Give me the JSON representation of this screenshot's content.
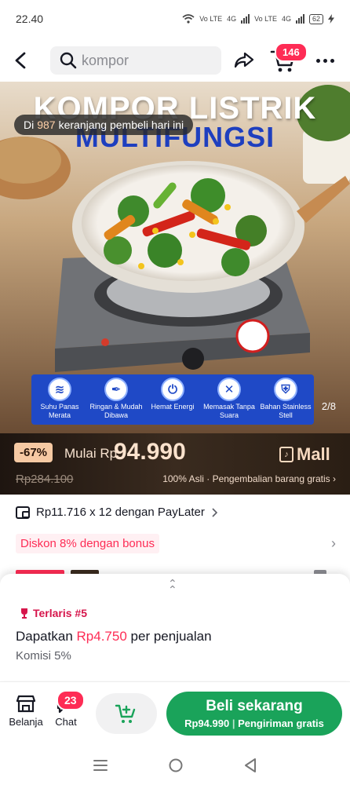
{
  "status_bar": {
    "time": "22.40",
    "network1": "Vo LTE",
    "network_type1": "4G",
    "network2": "Vo LTE",
    "network_type2": "4G",
    "battery": "62"
  },
  "top_nav": {
    "search_text": "kompor",
    "cart_count": "146"
  },
  "hero": {
    "title_line1": "KOMPOR LISTRIK",
    "title_line2": "MULTIFUNGSI",
    "buyers_prefix": "Di",
    "buyers_count": "987",
    "buyers_suffix": "keranjang pembeli hari ini",
    "page_indicator": "2/8",
    "features": [
      {
        "label": "Suhu Panas Merata",
        "icon": "heat-icon"
      },
      {
        "label": "Ringan & Mudah Dibawa",
        "icon": "feather-icon"
      },
      {
        "label": "Hemat Energi",
        "icon": "energy-icon"
      },
      {
        "label": "Memasak Tanpa Suara",
        "icon": "mute-icon"
      },
      {
        "label": "Bahan Stainless Stell",
        "icon": "shield-icon"
      }
    ]
  },
  "price_bar": {
    "discount": "-67%",
    "mulai": "Mulai Rp",
    "price": "94.990",
    "mall_label": "Mall",
    "old_price": "Rp284.100",
    "guarantee": "100% Asli · Pengembalian barang gratis ›"
  },
  "paylater": {
    "text": "Rp11.716 x 12 dengan PayLater"
  },
  "bonus": {
    "text": "Diskon 8% dengan bonus"
  },
  "affiliate": {
    "rank": "Terlaris #5",
    "commission_prefix": "Dapatkan",
    "commission_amount": "Rp4.750",
    "commission_suffix": "per penjualan",
    "rate": "Komisi 5%"
  },
  "bottom_bar": {
    "shop_label": "Belanja",
    "chat_label": "Chat",
    "chat_badge": "23",
    "buy_label": "Beli sekarang",
    "buy_price": "Rp94.990",
    "buy_shipping": "Pengiriman gratis"
  },
  "colors": {
    "accent": "#fe2c55",
    "buy_green": "#1aa35a",
    "feature_blue": "#1f49c6",
    "price_bar_dark": "#2a1e14"
  }
}
